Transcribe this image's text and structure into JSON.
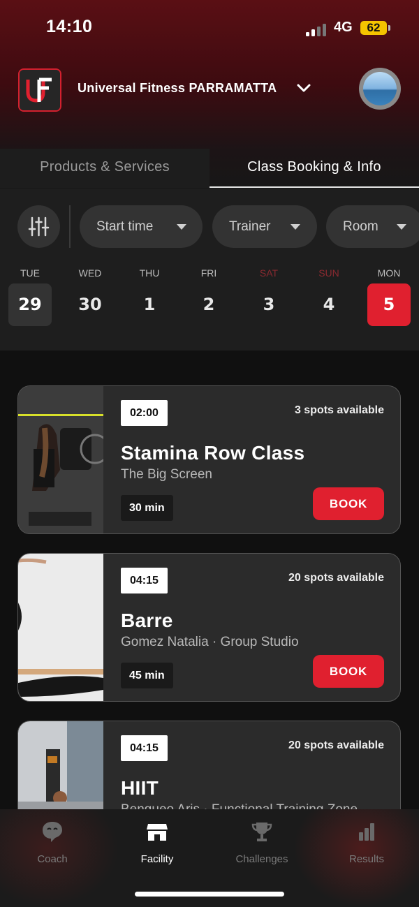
{
  "status": {
    "time": "14:10",
    "network": "4G",
    "battery": "62"
  },
  "header": {
    "venue": "Universal Fitness PARRAMATTA"
  },
  "tabs": [
    {
      "label": "Products & Services",
      "active": false
    },
    {
      "label": "Class Booking & Info",
      "active": true
    }
  ],
  "filters": {
    "start_time": "Start time",
    "trainer": "Trainer",
    "room": "Room"
  },
  "days": [
    {
      "name": "TUE",
      "num": "29",
      "state": "today"
    },
    {
      "name": "WED",
      "num": "30",
      "state": ""
    },
    {
      "name": "THU",
      "num": "1",
      "state": ""
    },
    {
      "name": "FRI",
      "num": "2",
      "state": ""
    },
    {
      "name": "SAT",
      "num": "3",
      "state": "weekend"
    },
    {
      "name": "SUN",
      "num": "4",
      "state": "weekend"
    },
    {
      "name": "MON",
      "num": "5",
      "state": "selected"
    }
  ],
  "classes": [
    {
      "time": "02:00",
      "spots": "3 spots available",
      "title": "Stamina Row Class",
      "subtitle": "The Big Screen",
      "duration": "30 min",
      "book": "BOOK"
    },
    {
      "time": "04:15",
      "spots": "20 spots available",
      "title": "Barre",
      "subtitle": "Gomez Natalia  ·  Group Studio",
      "duration": "45 min",
      "book": "BOOK"
    },
    {
      "time": "04:15",
      "spots": "20 spots available",
      "title": "HIIT",
      "subtitle": "Bengueo Aris  ·  Functional Training Zone",
      "duration": "",
      "book": ""
    }
  ],
  "nav": {
    "coach": "Coach",
    "facility": "Facility",
    "challenges": "Challenges",
    "results": "Results"
  },
  "colors": {
    "accent": "#e0202f",
    "header": "#5a0f14"
  }
}
